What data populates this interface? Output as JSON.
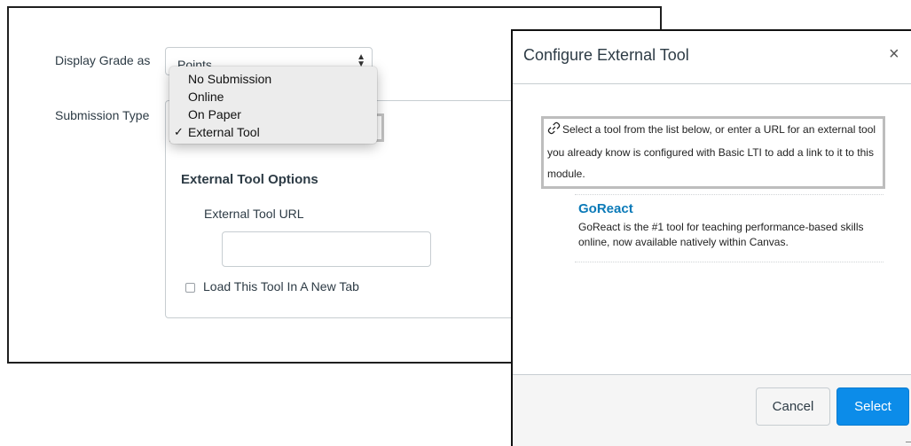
{
  "form": {
    "display_grade_label": "Display Grade as",
    "display_grade_value": "Points",
    "submission_type_label": "Submission Type",
    "submission_type_options": [
      {
        "label": "No Submission",
        "checked": false
      },
      {
        "label": "Online",
        "checked": false
      },
      {
        "label": "On Paper",
        "checked": false
      },
      {
        "label": "External Tool",
        "checked": true
      }
    ],
    "check_mark": "✓",
    "external_tool_options_heading": "External Tool Options",
    "external_tool_url_label": "External Tool URL",
    "external_tool_url_value": "",
    "new_tab_label": "Load This Tool In A New Tab"
  },
  "modal": {
    "title": "Configure External Tool",
    "close_glyph": "×",
    "instructions": "Select a tool from the list below, or enter a URL for an external tool you already know is configured with Basic LTI to add a link to it to this module.",
    "tools": [
      {
        "name": "GoReact",
        "description": "GoReact is the #1 tool for teaching performance-based skills online, now available natively within Canvas."
      }
    ],
    "cancel_label": "Cancel",
    "select_label": "Select"
  },
  "colors": {
    "accent": "#0c8ce9",
    "link": "#0b7ab8"
  },
  "icons": {
    "link": "link-icon",
    "close": "close-icon",
    "select_arrows": "updown-arrows-icon"
  }
}
